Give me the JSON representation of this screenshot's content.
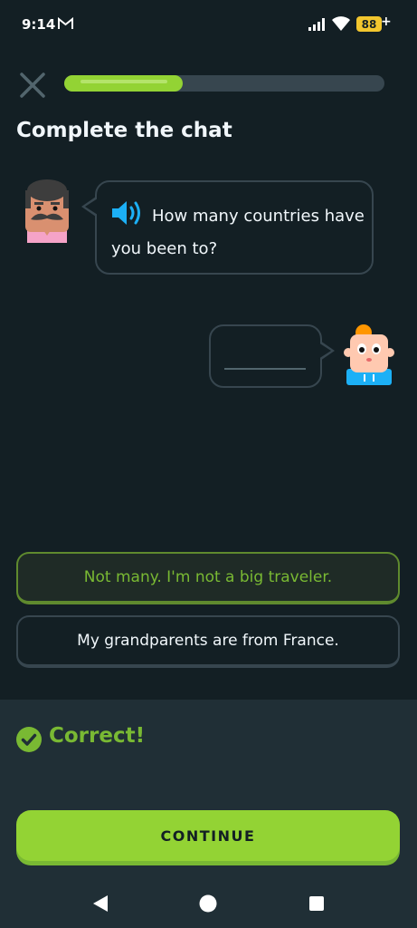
{
  "status_bar": {
    "time": "9:14",
    "battery_level": "88",
    "battery_charging": "+",
    "icons": [
      "gmail-icon",
      "signal-icon",
      "wifi-icon",
      "battery-icon"
    ]
  },
  "header": {
    "close_icon": "close-icon",
    "progress": 0.37
  },
  "title": "Complete the chat",
  "conversation": {
    "prompt": "How many countries have you been to?",
    "speaker_icon": "speaker-icon"
  },
  "options": [
    {
      "label": "Not many. I'm not a big traveler.",
      "state": "selected-correct"
    },
    {
      "label": "My grandparents are from France.",
      "state": "default"
    }
  ],
  "feedback": {
    "status": "Correct!",
    "icon": "check-circle-icon",
    "continue_label": "CONTINUE"
  },
  "nav_bar": {
    "icons": [
      "back-icon",
      "home-icon",
      "recents-icon"
    ]
  },
  "colors": {
    "background": "#131f24",
    "accent_green": "#93d334",
    "correct_text": "#79b933",
    "border": "#37464f",
    "speaker_blue": "#1cb0f6",
    "battery": "#f2c62e"
  }
}
